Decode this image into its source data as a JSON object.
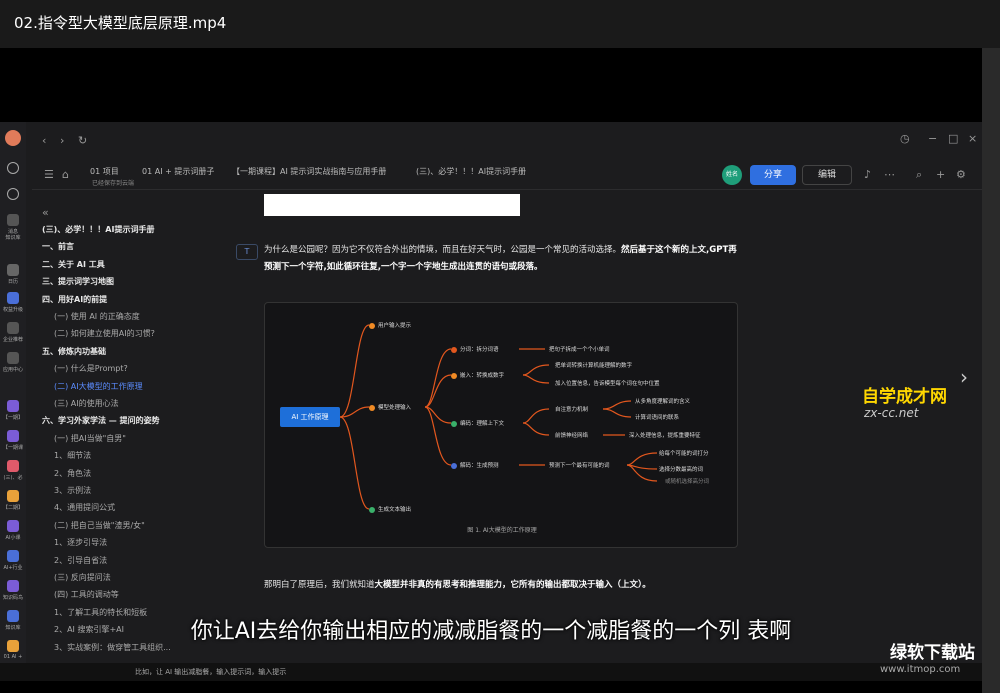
{
  "player": {
    "title": "02.指令型大模型底层原理.mp4"
  },
  "app": {
    "breadcrumb": [
      "01 项目",
      "01 AI + 提示词册子",
      "【一期课程】AI 提示词实战指南与应用手册",
      "(三)、必学！！！AI提示词手册"
    ],
    "breadcrumb_sub": "已经保存到云端",
    "avatar_label": "姓名",
    "share_label": "分享",
    "edit_label": "编辑",
    "sidebar_labels": [
      "消息",
      "知识库",
      "日历",
      "权益升级",
      "企业推荐",
      "应用中心",
      "【一期】",
      "【一期课",
      "(三)、必",
      "【二期】",
      "AI小课",
      "AI+行业",
      "知识码鸟",
      "知识库",
      "01 AI +"
    ]
  },
  "toc": {
    "items": [
      {
        "text": "(三)、必学！！！AI提示词手册",
        "level": 1
      },
      {
        "text": "一、前言",
        "level": 1
      },
      {
        "text": "二、关于 AI 工具",
        "level": 1
      },
      {
        "text": "三、提示词学习地图",
        "level": 1
      },
      {
        "text": "四、用好AI的前提",
        "level": 1
      },
      {
        "text": "(一) 使用 AI 的正确态度",
        "level": 2
      },
      {
        "text": "(二) 如何建立使用AI的习惯?",
        "level": 2
      },
      {
        "text": "五、修炼内功基础",
        "level": 1
      },
      {
        "text": "(一) 什么是Prompt?",
        "level": 2
      },
      {
        "text": "(二) AI大模型的工作原理",
        "level": 2,
        "active": true
      },
      {
        "text": "(三) AI的使用心法",
        "level": 2
      },
      {
        "text": "六、学习外家学法 — 提问的姿势",
        "level": 1
      },
      {
        "text": "(一) 把AI当做\"自男\"",
        "level": 2
      },
      {
        "text": "1、细节法",
        "level": 2
      },
      {
        "text": "2、角色法",
        "level": 2
      },
      {
        "text": "3、示例法",
        "level": 2
      },
      {
        "text": "4、通用提问公式",
        "level": 2
      },
      {
        "text": "(二) 把自己当做\"渣男/女\"",
        "level": 2
      },
      {
        "text": "1、逐步引导法",
        "level": 2
      },
      {
        "text": "2、引导自省法",
        "level": 2
      },
      {
        "text": "(三) 反向提问法",
        "level": 2
      },
      {
        "text": "(四) 工具的调动等",
        "level": 2
      },
      {
        "text": "1、了解工具的特长和短板",
        "level": 2
      },
      {
        "text": "2、AI 搜索引擎+AI",
        "level": 2
      },
      {
        "text": "3、实战案例：做穿管工具组织...",
        "level": 2
      }
    ]
  },
  "doc": {
    "para1_normal": "为什么是公园呢？因为它不仅符合外出的情境，而且在好天气时，公园是一个常见的活动选择。",
    "para1_bold": "然后基于这个新的上文,GPT再预测下一个字符,如此循环往复,一个字一个字地生成出连贯的语句或段落。",
    "t_badge": "T",
    "para2_normal": "那明白了原理后，我们就知道",
    "para2_bold": "大模型并非真的有思考和推理能力，它所有的输出都取决于输入（上文）。"
  },
  "mindmap": {
    "root": "AI 工作原理",
    "branches": [
      {
        "label": "用户输入提示"
      },
      {
        "label": "模型处理输入"
      },
      {
        "label": "生成文本输出"
      }
    ],
    "steps": [
      {
        "label": "分词：拆分词语",
        "detail": "把句子拆成一个个小单词"
      },
      {
        "label": "嵌入：转换成数字",
        "detail1": "把单词转换计算机能理解的数字",
        "detail2": "加入位置信息，告诉模型每个词在句中位置"
      },
      {
        "label": "编码：理解上下文",
        "detail1": "自注意力机制",
        "detail2": "前馈神经网络",
        "sub1": "从多角度理解词的含义",
        "sub2": "计算词语间的联系",
        "sub3": "深入处理信息，提炼重要特征"
      },
      {
        "label": "解码：生成预测",
        "detail": "预测下一个最有可能的词",
        "sub1": "给每个可能的词打分",
        "sub2": "选择分数最高的词",
        "sub3": "或随机选择高分词"
      }
    ],
    "caption": "图 1. AI大模型的工作原理",
    "colors": {
      "root": "#1e6fd9",
      "dot": "#f08a24",
      "line": "#e2571e"
    }
  },
  "overlay": {
    "subtitle": "你让AI去给你输出相应的减减脂餐的一个减脂餐的一个列 表啊",
    "watermark1": "自学成才网",
    "watermark1_url": "zx-cc.net",
    "watermark2": "绿软下载站",
    "watermark2_url": "www.itmop.com",
    "taskbar_text": "比如，让 AI 输出减脂餐，输入提示词，输入提示"
  }
}
